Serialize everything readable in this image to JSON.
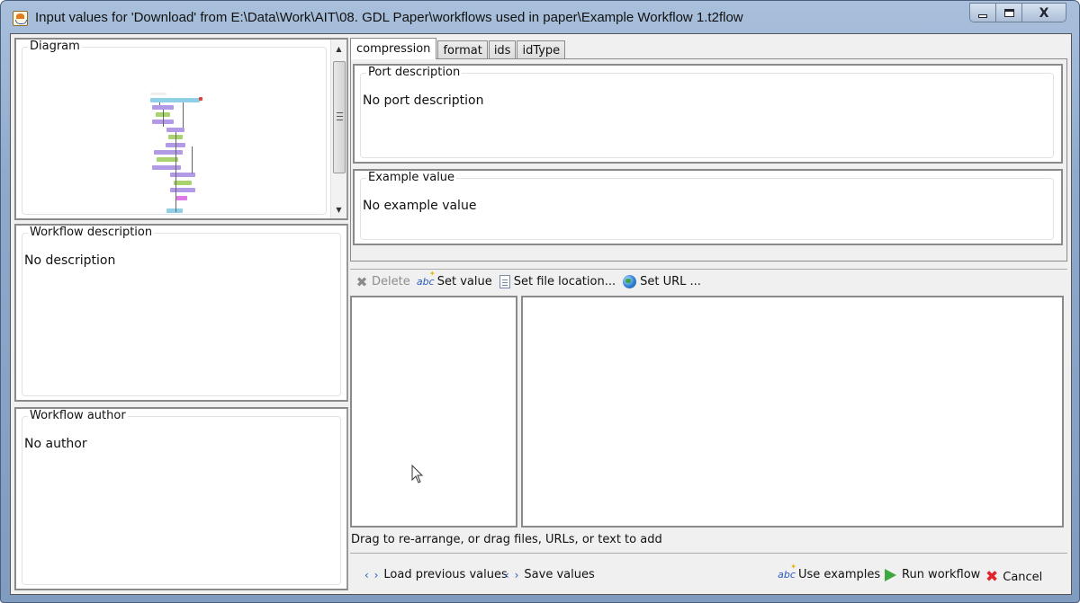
{
  "window": {
    "title": "Input values for 'Download' from E:\\Data\\Work\\AIT\\08. GDL Paper\\workflows used in paper\\Example Workflow 1.t2flow",
    "minimize_glyph": "",
    "maximize_glyph": "",
    "close_glyph": "X"
  },
  "left": {
    "diagram": {
      "label": "Diagram",
      "scroll_up": "▲",
      "scroll_down": "▼"
    },
    "description": {
      "label": "Workflow description",
      "value": "No description"
    },
    "author": {
      "label": "Workflow author",
      "value": "No author"
    }
  },
  "right": {
    "tabs": [
      {
        "label": "compression",
        "active": true
      },
      {
        "label": "format",
        "active": false
      },
      {
        "label": "ids",
        "active": false
      },
      {
        "label": "idType",
        "active": false
      }
    ],
    "port_description": {
      "label": "Port description",
      "value": "No port description"
    },
    "example_value": {
      "label": "Example value",
      "value": "No example value"
    },
    "toolbar": {
      "delete": {
        "label": "Delete",
        "icon": "✖",
        "enabled": false
      },
      "set_value": {
        "label": "Set value",
        "icon": "abc"
      },
      "set_file_location": {
        "label": "Set file location..."
      },
      "set_url": {
        "label": "Set URL ..."
      }
    },
    "hint": "Drag to re-arrange, or drag files, URLs, or text to add"
  },
  "bottom": {
    "load_previous": {
      "label": "Load previous values",
      "icon": "‹ ›"
    },
    "save_values": {
      "label": "Save values",
      "icon": "‹ ›"
    },
    "use_examples": {
      "label": "Use examples",
      "icon": "abc"
    },
    "run_workflow": {
      "label": "Run workflow"
    },
    "cancel": {
      "label": "Cancel",
      "icon": "✖"
    }
  },
  "colors": {
    "title_bar": "#8ea9cc",
    "client_bg": "#f0f0f0",
    "run_green": "#3da83d",
    "cancel_red": "#e0242a",
    "link_blue": "#2a5bbf"
  }
}
